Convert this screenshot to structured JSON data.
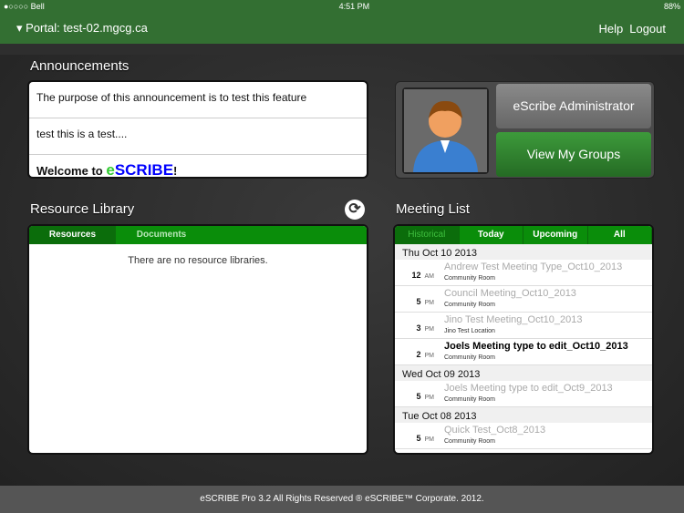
{
  "status_bar": {
    "carrier": "●○○○○ Bell",
    "time": "4:51 PM",
    "battery": "88%"
  },
  "header": {
    "portal": "▾ Portal: test-02.mgcg.ca",
    "help": "Help",
    "logout": "Logout"
  },
  "announcements": {
    "title": "Announcements",
    "items": [
      "The purpose of this announcement is to test this feature",
      "test this is a test...."
    ],
    "welcome_prefix": "Welcome to ",
    "welcome_e": "e",
    "welcome_scribe": "SCRIBE",
    "welcome_suffix": "!"
  },
  "profile": {
    "name": "eScribe Administrator",
    "view_groups": "View My Groups"
  },
  "resource_library": {
    "title": "Resource Library",
    "tabs": [
      "Resources",
      "Documents"
    ],
    "empty": "There are no resource libraries."
  },
  "meeting_list": {
    "title": "Meeting List",
    "tabs": [
      "Historical",
      "Today",
      "Upcoming",
      "All"
    ],
    "groups": [
      {
        "date": "Thu  Oct 10  2013",
        "meetings": [
          {
            "hour": "12",
            "ampm": "AM",
            "title": "Andrew Test Meeting Type_Oct10_2013",
            "location": "Community Room",
            "active": false
          },
          {
            "hour": "5",
            "ampm": "PM",
            "title": "Council Meeting_Oct10_2013",
            "location": "Community Room",
            "active": false
          },
          {
            "hour": "3",
            "ampm": "PM",
            "title": "Jino Test Meeting_Oct10_2013",
            "location": "Jino Test Location",
            "active": false
          },
          {
            "hour": "2",
            "ampm": "PM",
            "title": "Joels Meeting type to edit_Oct10_2013",
            "location": "Community Room",
            "active": true
          }
        ]
      },
      {
        "date": "Wed  Oct 09  2013",
        "meetings": [
          {
            "hour": "5",
            "ampm": "PM",
            "title": "Joels Meeting type to edit_Oct9_2013",
            "location": "Community Room",
            "active": false
          }
        ]
      },
      {
        "date": "Tue  Oct 08  2013",
        "meetings": [
          {
            "hour": "5",
            "ampm": "PM",
            "title": "Quick Test_Oct8_2013",
            "location": "Community Room",
            "active": false
          }
        ]
      }
    ]
  },
  "footer": "eSCRIBE Pro 3.2    All Rights Reserved ® eSCRIBE™ Corporate. 2012."
}
